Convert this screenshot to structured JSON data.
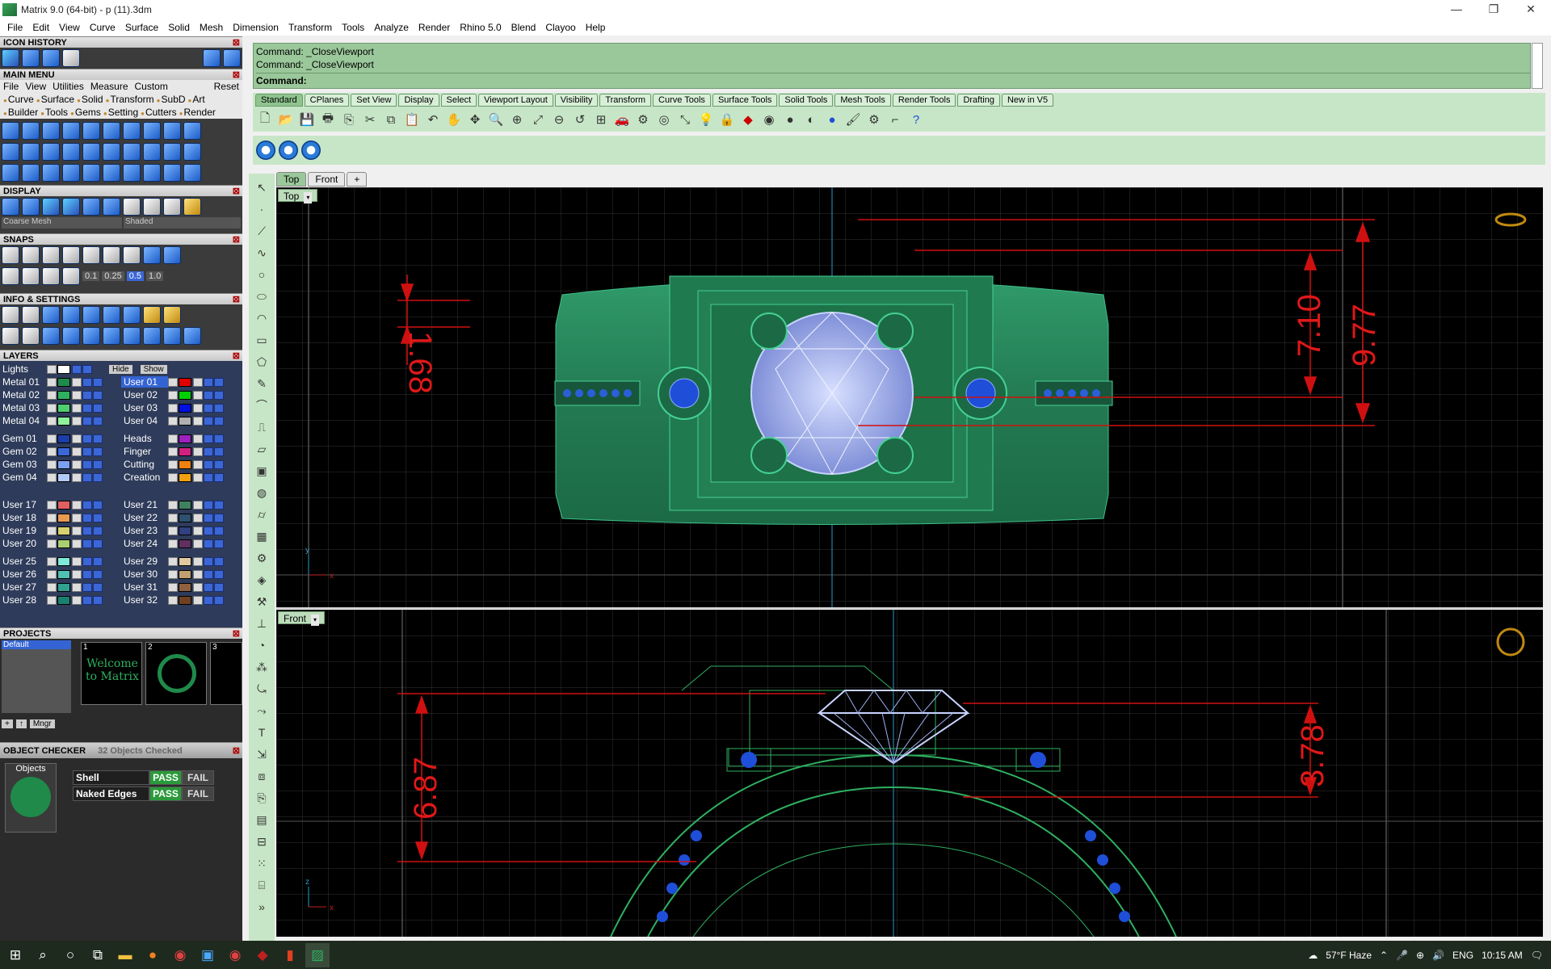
{
  "window": {
    "title": "Matrix 9.0 (64-bit) - p (11).3dm",
    "minimize": "—",
    "restore": "❐",
    "close": "✕"
  },
  "menubar": [
    "File",
    "Edit",
    "View",
    "Curve",
    "Surface",
    "Solid",
    "Mesh",
    "Dimension",
    "Transform",
    "Tools",
    "Analyze",
    "Render",
    "Rhino 5.0",
    "Blend",
    "Clayoo",
    "Help"
  ],
  "left_panel": {
    "icon_history": "ICON HISTORY",
    "main_menu": {
      "title": "MAIN MENU",
      "row1": [
        "File",
        "View",
        "Utilities",
        "Measure",
        "Custom"
      ],
      "reset": "Reset",
      "row2": [
        "Curve",
        "Surface",
        "Solid",
        "Transform",
        "SubD",
        "Art"
      ],
      "row3": [
        "Builder",
        "Tools",
        "Gems",
        "Setting",
        "Cutters",
        "Render"
      ]
    },
    "display": {
      "title": "DISPLAY",
      "mesh_select": "Coarse Mesh",
      "mode_select": "Shaded"
    },
    "snaps": {
      "title": "SNAPS",
      "values": [
        "0.1",
        "0.25",
        "0.5",
        "1.0"
      ]
    },
    "info_settings": "INFO & SETTINGS",
    "layers": {
      "title": "LAYERS",
      "lights": "Lights",
      "hide": "Hide",
      "show": "Show",
      "left": [
        {
          "name": "Metal 01",
          "color": "#1f8a4a"
        },
        {
          "name": "Metal 02",
          "color": "#2fb060"
        },
        {
          "name": "Metal 03",
          "color": "#4ed070"
        },
        {
          "name": "Metal 04",
          "color": "#8ef29a"
        },
        {
          "name": "Gem 01",
          "color": "#1d3ea8"
        },
        {
          "name": "Gem 02",
          "color": "#3a68d8"
        },
        {
          "name": "Gem 03",
          "color": "#7aa0f0"
        },
        {
          "name": "Gem 04",
          "color": "#b2caf8"
        },
        {
          "name": "User 17",
          "color": "#e06060"
        },
        {
          "name": "User 18",
          "color": "#e89a50"
        },
        {
          "name": "User 19",
          "color": "#d8d070"
        },
        {
          "name": "User 20",
          "color": "#a8d070"
        },
        {
          "name": "User 25",
          "color": "#80e8d8"
        },
        {
          "name": "User 26",
          "color": "#50c0b0"
        },
        {
          "name": "User 27",
          "color": "#30a090"
        },
        {
          "name": "User 28",
          "color": "#1a8070"
        }
      ],
      "right": [
        {
          "name": "User 01",
          "color": "#e00000"
        },
        {
          "name": "User 02",
          "color": "#00d000"
        },
        {
          "name": "User 03",
          "color": "#0010e0"
        },
        {
          "name": "User 04",
          "color": "#b0b0b0"
        },
        {
          "name": "Heads",
          "color": "#a020c0"
        },
        {
          "name": "Finger",
          "color": "#d02080"
        },
        {
          "name": "Cutting",
          "color": "#f08010"
        },
        {
          "name": "Creation",
          "color": "#f0a010"
        },
        {
          "name": "User 21",
          "color": "#408060"
        },
        {
          "name": "User 22",
          "color": "#305070"
        },
        {
          "name": "User 23",
          "color": "#304080"
        },
        {
          "name": "User 24",
          "color": "#603060"
        },
        {
          "name": "User 29",
          "color": "#e0c8a0"
        },
        {
          "name": "User 30",
          "color": "#c0a070"
        },
        {
          "name": "User 31",
          "color": "#906040"
        },
        {
          "name": "User 32",
          "color": "#704020"
        }
      ]
    },
    "projects": {
      "title": "PROJECTS",
      "default": "Default",
      "thumbs": [
        "1",
        "2",
        "3"
      ],
      "welcome": "Welcome to Matrix",
      "mngr": "Mngr"
    },
    "object_checker": {
      "title": "OBJECT CHECKER",
      "count": "32 Objects Checked",
      "objects_label": "Objects",
      "rows": [
        {
          "label": "Shell",
          "pass": "PASS",
          "fail": "FAIL"
        },
        {
          "label": "Naked Edges",
          "pass": "PASS",
          "fail": "FAIL"
        }
      ]
    }
  },
  "command": {
    "lines": [
      "Command: _CloseViewport",
      "Command: _CloseViewport"
    ],
    "prompt": "Command:"
  },
  "toolbar_tabs": [
    "Standard",
    "CPlanes",
    "Set View",
    "Display",
    "Select",
    "Viewport Layout",
    "Visibility",
    "Transform",
    "Curve Tools",
    "Surface Tools",
    "Solid Tools",
    "Mesh Tools",
    "Render Tools",
    "Drafting",
    "New in V5"
  ],
  "viewport_tabs": [
    "Top",
    "Front",
    "+"
  ],
  "viewports": {
    "top": {
      "label": "Top",
      "dims": {
        "left": "1.68",
        "mid": "7.10",
        "right": "9.77"
      },
      "axis_y": "y",
      "axis_x": "x"
    },
    "front": {
      "label": "Front",
      "dims": {
        "left": "6.87",
        "right": "3.78"
      },
      "axis_z": "z",
      "axis_x": "x"
    }
  },
  "taskbar": {
    "weather": "57°F  Haze",
    "lang": "ENG",
    "time": "10:15 AM"
  }
}
